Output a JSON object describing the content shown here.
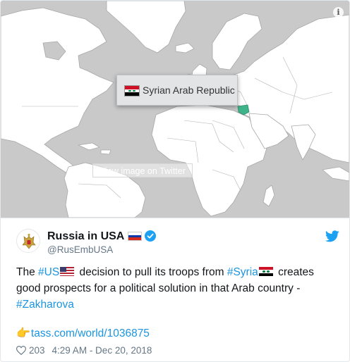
{
  "media": {
    "tooltip_country": "Syrian Arab Republic",
    "view_image_label": "View image on Twitter",
    "info_icon": "info-icon",
    "colors": {
      "ocean": "#c9c9c9",
      "land": "#ffffff",
      "highlight": "#3fb38a"
    }
  },
  "author": {
    "name": "Russia in USA",
    "handle": "@RusEmbUSA",
    "verified": true,
    "flag_icon": "russia-flag-icon"
  },
  "tweet": {
    "pre_1": "The ",
    "hashtag_us": "#US",
    "mid_1": " decision to pull its troops from ",
    "hashtag_syria": "#Syria",
    "mid_2": " creates good prospects for a political solution in that Arab country - ",
    "hashtag_zakharova": "#Zakharova",
    "link_emoji": "👉",
    "link": "tass.com/world/1036875"
  },
  "footer": {
    "likes": "203",
    "timestamp": "4:29 AM - Dec 20, 2018"
  }
}
